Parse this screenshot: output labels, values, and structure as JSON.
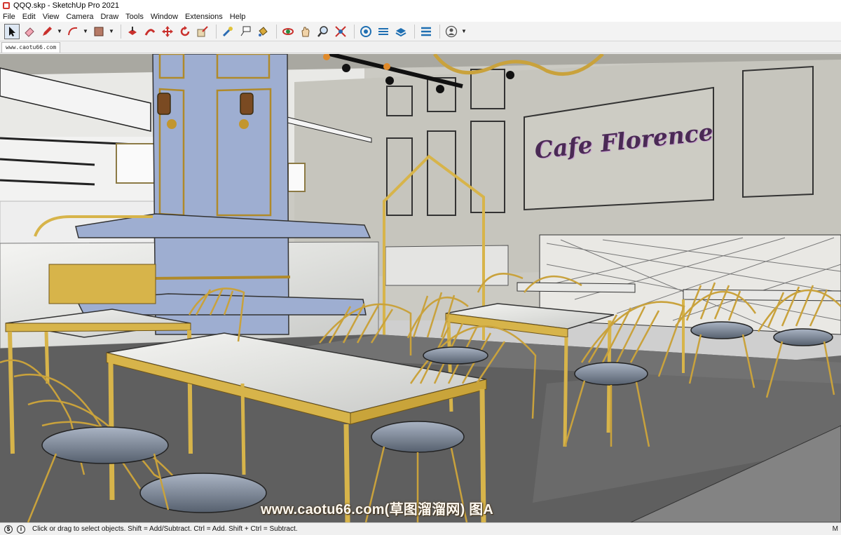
{
  "window": {
    "title": "QQQ.skp - SketchUp Pro 2021"
  },
  "menu": {
    "items": [
      "File",
      "Edit",
      "View",
      "Camera",
      "Draw",
      "Tools",
      "Window",
      "Extensions",
      "Help"
    ]
  },
  "toolbar": {
    "tools": [
      "select-icon",
      "eraser-icon",
      "pencil-icon",
      "arc-icon",
      "shape-icon",
      "push-pull-icon",
      "move-icon",
      "rotate-icon",
      "scale-icon",
      "offset-icon",
      "tape-measure-icon",
      "text-icon",
      "paint-bucket-icon",
      "orbit-icon",
      "pan-icon",
      "zoom-icon",
      "zoom-extents-icon",
      "warehouse-icon",
      "extension-warehouse-icon",
      "layout-icon",
      "model-info-icon",
      "account-icon"
    ]
  },
  "tab": {
    "label": "www.caotu66.com"
  },
  "scene": {
    "sign_text": "Cafe Florence",
    "watermark": "www.caotu66.com(草图溜溜网) 图A"
  },
  "status": {
    "hint": "Click or drag to select objects. Shift = Add/Subtract. Ctrl = Add. Shift + Ctrl = Subtract.",
    "right_label": "M"
  },
  "colors": {
    "accent": "#d9b342",
    "pillar": "#9eaed1",
    "wall": "#c9c8c0",
    "floor": "#5e5e5e"
  }
}
